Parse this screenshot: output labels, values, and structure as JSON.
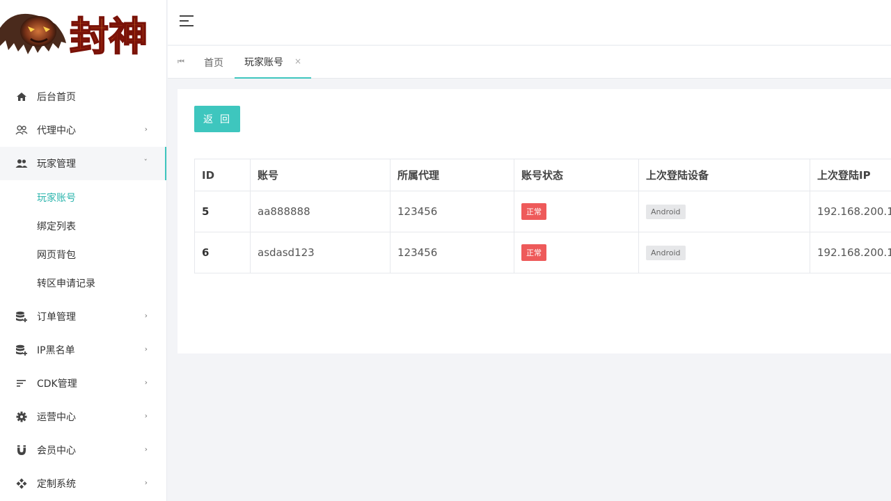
{
  "logo": {
    "text": "封神"
  },
  "sidebar": {
    "items": [
      {
        "label": "后台首页",
        "icon": "home-icon",
        "has_children": false
      },
      {
        "label": "代理中心",
        "icon": "agents-icon",
        "has_children": true
      },
      {
        "label": "玩家管理",
        "icon": "users-icon",
        "has_children": true,
        "open": true,
        "children": [
          {
            "label": "玩家账号",
            "active": true
          },
          {
            "label": "绑定列表"
          },
          {
            "label": "网页背包"
          },
          {
            "label": "转区申请记录"
          }
        ]
      },
      {
        "label": "订单管理",
        "icon": "database-add-icon",
        "has_children": true
      },
      {
        "label": "IP黑名单",
        "icon": "database-add-icon",
        "has_children": true
      },
      {
        "label": "CDK管理",
        "icon": "sort-lines-icon",
        "has_children": true
      },
      {
        "label": "运营中心",
        "icon": "gear-icon",
        "has_children": true
      },
      {
        "label": "会员中心",
        "icon": "magnet-icon",
        "has_children": true
      },
      {
        "label": "定制系统",
        "icon": "modules-icon",
        "has_children": true
      }
    ]
  },
  "tabs": {
    "home": "首页",
    "current": "玩家账号",
    "close_symbol": "×"
  },
  "content": {
    "back_button": "返回",
    "table": {
      "columns": [
        "ID",
        "账号",
        "所属代理",
        "账号状态",
        "上次登陆设备",
        "上次登陆IP"
      ],
      "rows": [
        {
          "id": "5",
          "account": "aa888888",
          "agent": "123456",
          "status": "正常",
          "device": "Android",
          "ip": "192.168.200.1"
        },
        {
          "id": "6",
          "account": "asdasd123",
          "agent": "123456",
          "status": "正常",
          "device": "Android",
          "ip": "192.168.200.1"
        }
      ]
    }
  },
  "colors": {
    "accent": "#3ec6be",
    "status_normal": "#ee5a5a",
    "device_badge": "#e6e7e9"
  }
}
